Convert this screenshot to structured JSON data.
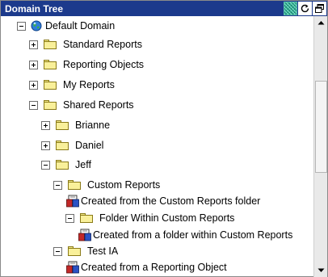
{
  "window": {
    "title": "Domain Tree",
    "buttons": [
      {
        "icon": "dither-pattern-icon"
      },
      {
        "icon": "refresh-icon"
      },
      {
        "icon": "restore-window-icon"
      }
    ]
  },
  "tree": {
    "root": "Default Domain",
    "standard_reports": "Standard Reports",
    "reporting_objects": "Reporting Objects",
    "my_reports": "My Reports",
    "shared_reports": "Shared Reports",
    "brianne": "Brianne",
    "daniel": "Daniel",
    "jeff": "Jeff",
    "custom_reports": "Custom Reports",
    "created_custom": "Created from the Custom Reports folder",
    "folder_within": "Folder Within Custom Reports",
    "created_within": "Created from a folder within Custom Reports",
    "test_ia": "Test IA",
    "created_object": "Created from a Reporting Object"
  },
  "colors": {
    "titlebar": "#1c3a8c",
    "folder": "#f9f09a"
  }
}
